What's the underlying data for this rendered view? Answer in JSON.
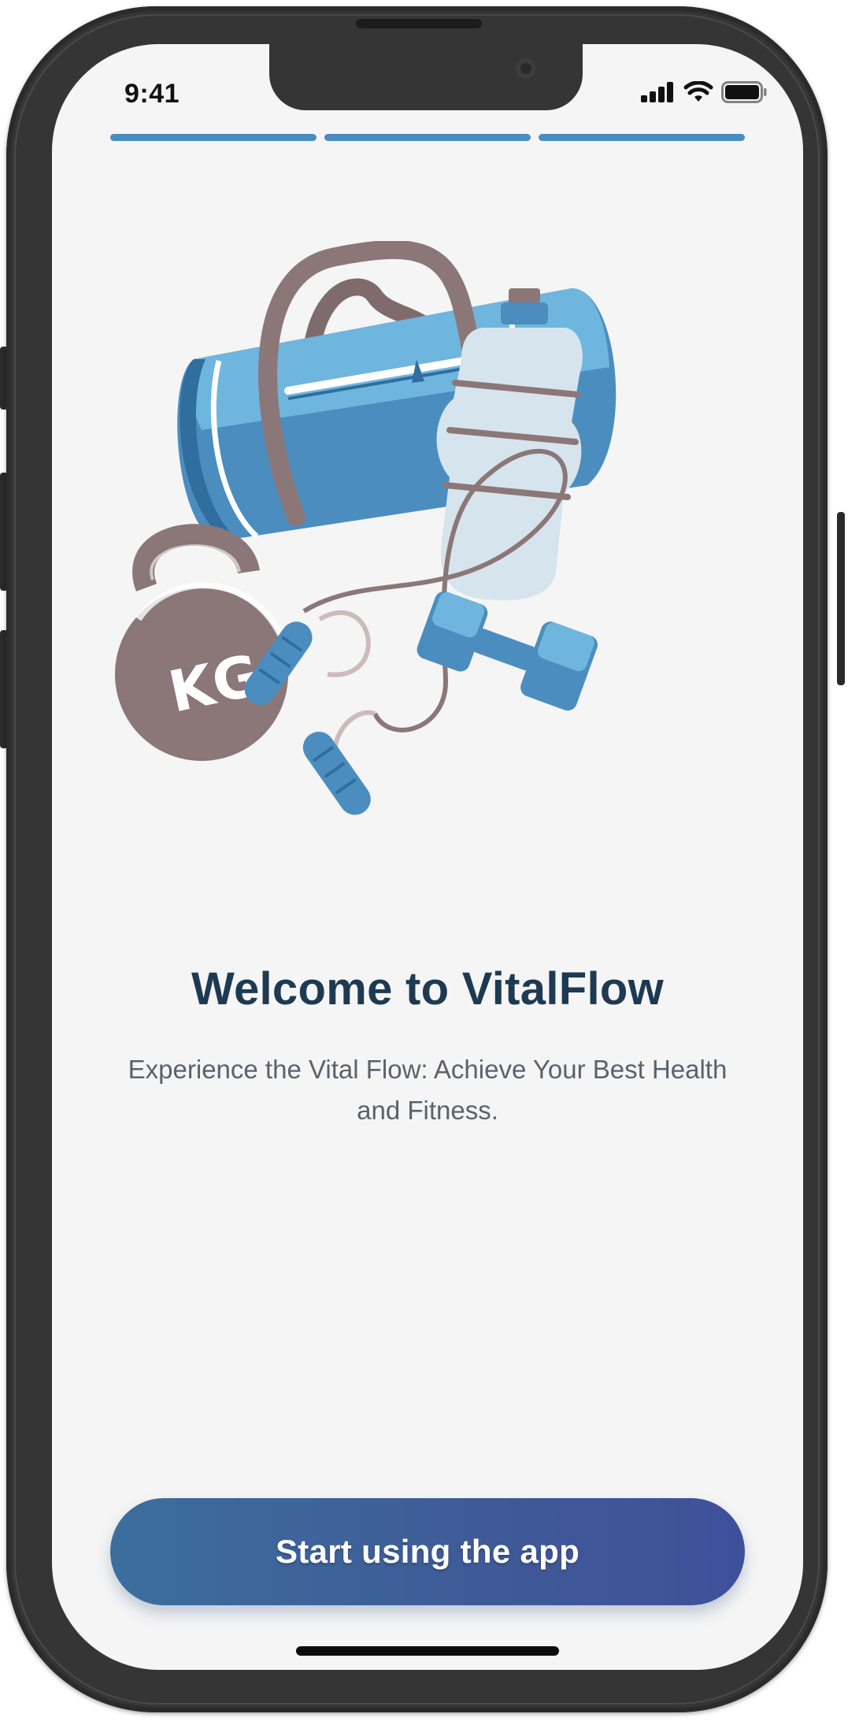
{
  "status_bar": {
    "time": "9:41",
    "icons": [
      "signal-icon",
      "wifi-icon",
      "battery-icon"
    ]
  },
  "onboarding": {
    "progress_total_steps": 3,
    "progress_completed_steps": 3,
    "illustration": "gym-bag-illustration",
    "title": "Welcome to VitalFlow",
    "subtitle": "Experience the Vital Flow: Achieve Your Best Health and Fitness.",
    "cta_label": "Start using the app",
    "kettlebell_label": "KG"
  },
  "colors": {
    "accent": "#4b8dbf",
    "title": "#1e3a52",
    "button_gradient_start": "#3c6e9d",
    "button_gradient_end": "#3f509a",
    "screen_background": "#f5f5f5"
  }
}
